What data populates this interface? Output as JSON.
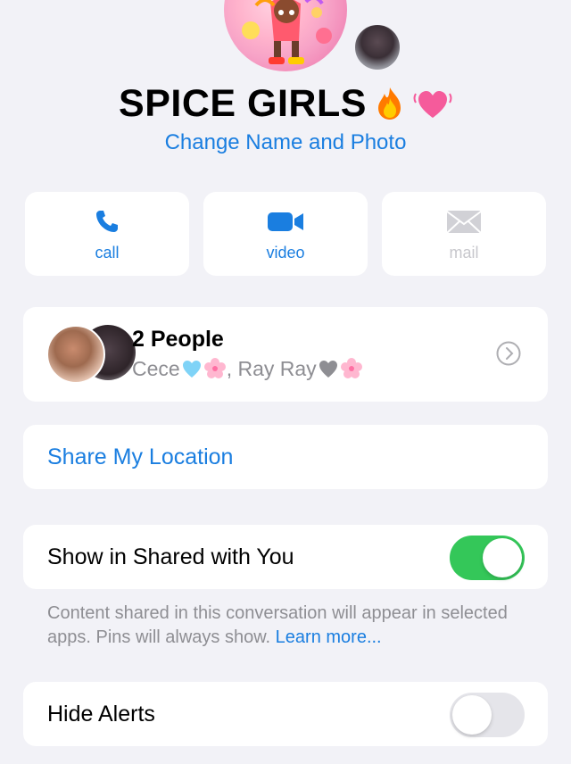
{
  "header": {
    "group_name": "SPICE GIRLS",
    "change_link": "Change Name and Photo"
  },
  "actions": [
    {
      "label": "call",
      "icon": "phone-icon",
      "enabled": true
    },
    {
      "label": "video",
      "icon": "video-camera-icon",
      "enabled": true
    },
    {
      "label": "mail",
      "icon": "envelope-icon",
      "enabled": false
    }
  ],
  "people": {
    "count_label": "2 People",
    "member1": "Cece",
    "separator": ", ",
    "member2": "Ray Ray"
  },
  "share_location": {
    "label": "Share My Location"
  },
  "shared_with_you": {
    "label": "Show in Shared with You",
    "enabled": true,
    "footnote": "Content shared in this conversation will appear in selected apps. Pins will always show.",
    "learn_more": "Learn more..."
  },
  "hide_alerts": {
    "label": "Hide Alerts",
    "enabled": false
  },
  "colors": {
    "accent": "#1a7ee0",
    "toggle_on": "#34c759",
    "toggle_off": "#e5e5ea",
    "background": "#f2f2f7"
  }
}
